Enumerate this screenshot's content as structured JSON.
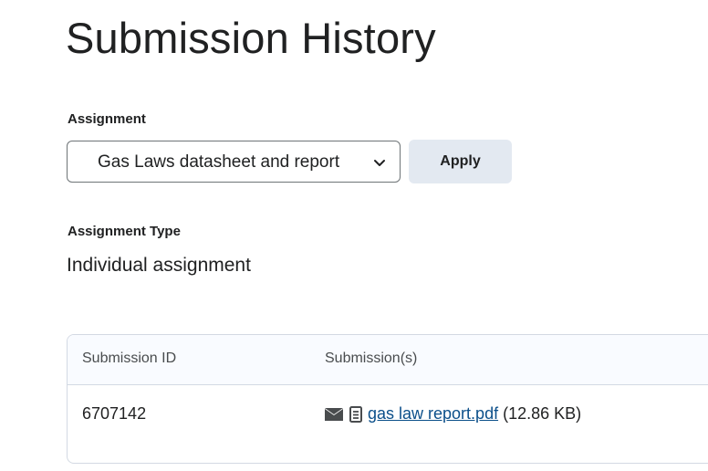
{
  "page": {
    "title": "Submission History"
  },
  "assignment": {
    "label": "Assignment",
    "selected": "Gas Laws datasheet and report",
    "apply_label": "Apply"
  },
  "assignment_type": {
    "label": "Assignment Type",
    "value": "Individual assignment"
  },
  "table": {
    "columns": [
      "Submission ID",
      "Submission(s)"
    ],
    "rows": [
      {
        "id": "6707142",
        "file_name": "gas law report.pdf",
        "file_size": "(12.86 KB)",
        "icons": [
          "envelope-icon",
          "document-icon"
        ]
      }
    ]
  },
  "colors": {
    "link": "#0b4f8a",
    "button_bg": "#e3e9f1",
    "border": "#d3d9e3"
  }
}
